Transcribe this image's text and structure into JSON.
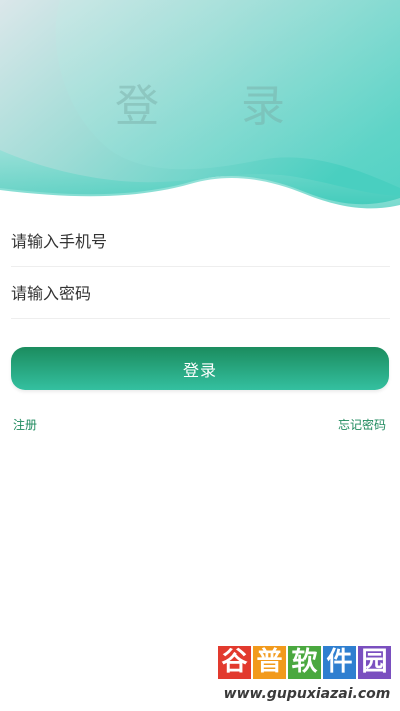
{
  "header": {
    "title": "登 录"
  },
  "form": {
    "phone_placeholder": "请输入手机号",
    "password_placeholder": "请输入密码",
    "login_label": "登录"
  },
  "links": {
    "register": "注册",
    "forgot_password": "忘记密码"
  },
  "watermark": {
    "chars": [
      "谷",
      "普",
      "软",
      "件",
      "园"
    ],
    "url": "www.gupuxiazai.com"
  },
  "colors": {
    "accent": "#1f8a5e",
    "header_teal": "#48cfc0",
    "button_top": "#1b8c5e",
    "button_bottom": "#34c0a0"
  }
}
